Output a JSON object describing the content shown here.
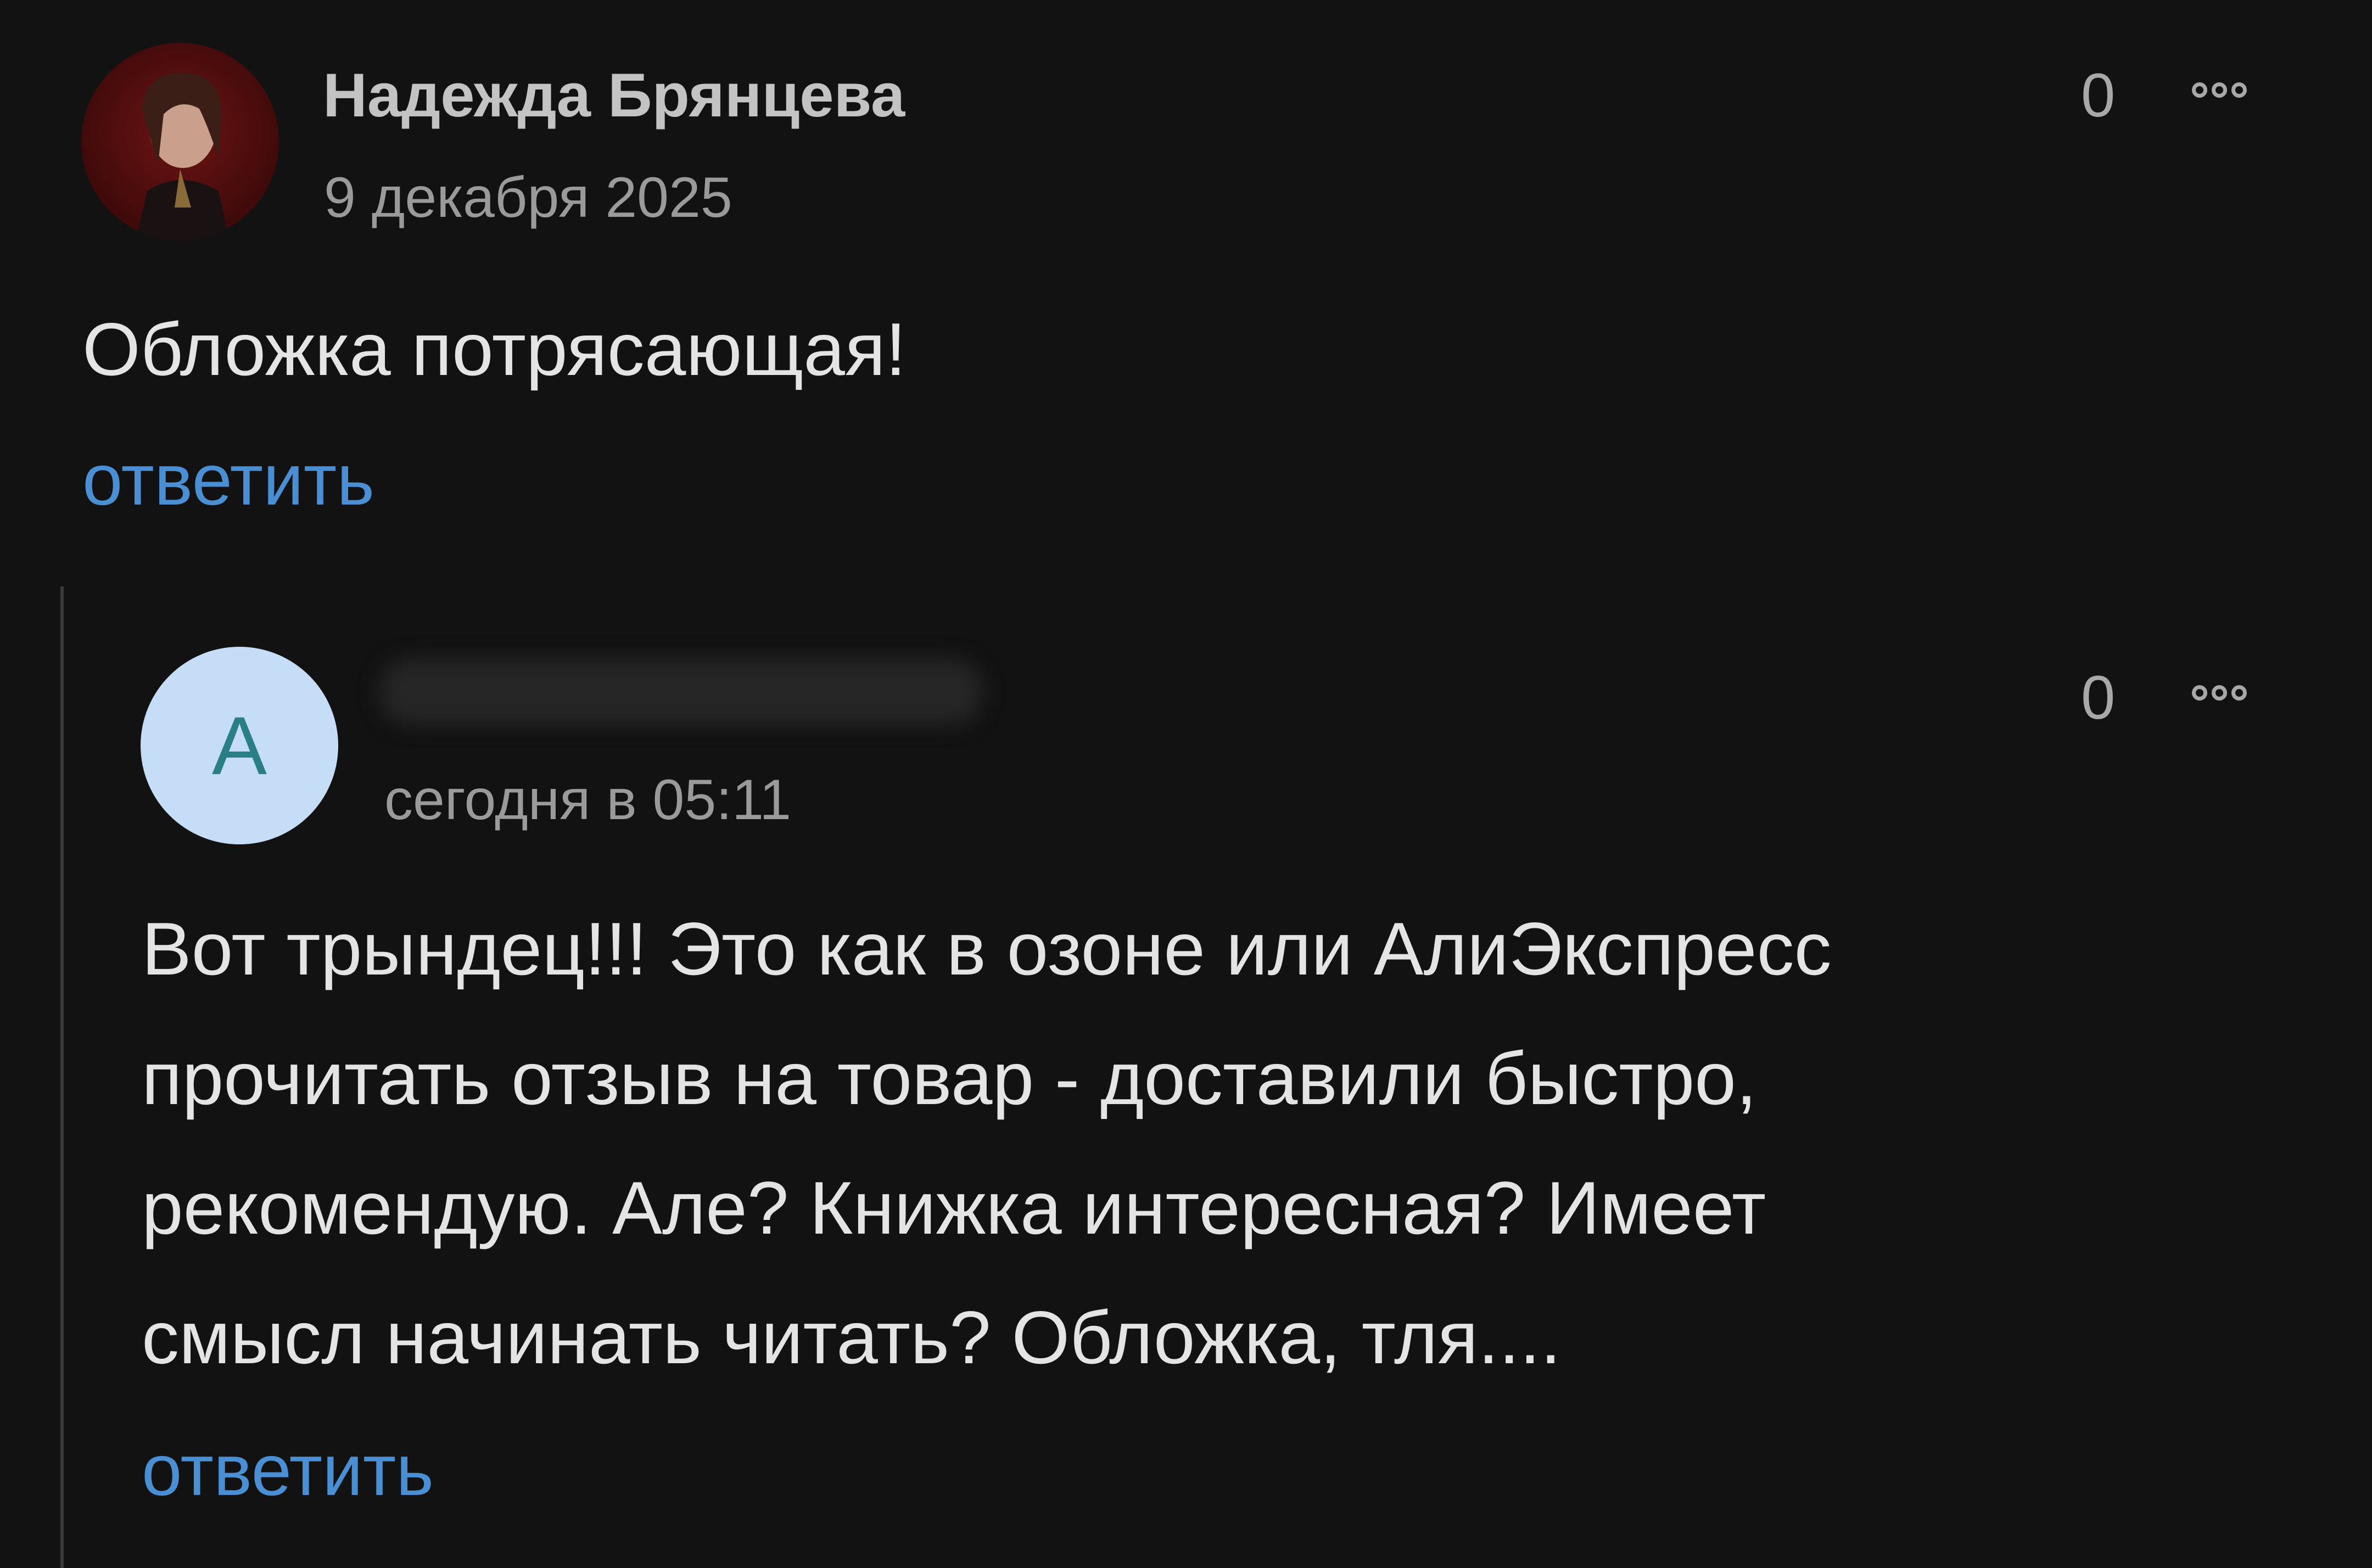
{
  "comments": [
    {
      "author": "Надежда Брянцева",
      "date": "9 декабря 2025",
      "rating": "0",
      "text_lines": [
        "Обложка потрясающая!"
      ],
      "reply_label": "ответить"
    },
    {
      "avatar_letter": "А",
      "date": "сегодня в 05:11",
      "rating": "0",
      "text_lines": [
        "Вот трындец!!! Это как в озоне или АлиЭкспресс",
        "прочитать отзыв на товар - доставили быстро,",
        "рекомендую. Але? Книжка интересная? Имеет",
        "смысл начинать читать? Обложка, тля...."
      ],
      "reply_label": "ответить"
    }
  ],
  "icons": {
    "more": "more-dots-icon"
  }
}
